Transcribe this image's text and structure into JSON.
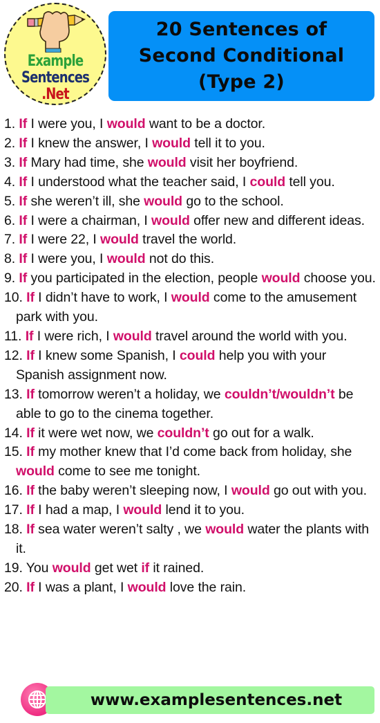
{
  "logo": {
    "line1": "Example",
    "line2": "Sentences",
    "line3": ".Net",
    "icon": "fist-holding-pencil-icon"
  },
  "title": {
    "line1": "20 Sentences of",
    "line2": "Second Conditional",
    "line3": "(Type 2)",
    "background": "#0590f7"
  },
  "highlight_color": "#d0106a",
  "sentences": [
    {
      "n": "1.",
      "parts": [
        {
          "t": "If",
          "h": true
        },
        {
          "t": " I were you, I "
        },
        {
          "t": "would",
          "h": true
        },
        {
          "t": " want to be a doctor."
        }
      ]
    },
    {
      "n": "2.",
      "parts": [
        {
          "t": "If",
          "h": true
        },
        {
          "t": " I knew the answer, I "
        },
        {
          "t": "would",
          "h": true
        },
        {
          "t": " tell it to you."
        }
      ]
    },
    {
      "n": "3.",
      "parts": [
        {
          "t": "If",
          "h": true
        },
        {
          "t": " Mary had time, she "
        },
        {
          "t": "would",
          "h": true
        },
        {
          "t": " visit her boyfriend."
        }
      ]
    },
    {
      "n": "4.",
      "parts": [
        {
          "t": "If",
          "h": true
        },
        {
          "t": " I understood what the teacher said, I "
        },
        {
          "t": "could",
          "h": true
        },
        {
          "t": " tell you."
        }
      ]
    },
    {
      "n": "5.",
      "parts": [
        {
          "t": "If",
          "h": true
        },
        {
          "t": " she weren’t ill, she "
        },
        {
          "t": "would",
          "h": true
        },
        {
          "t": " go to the school."
        }
      ]
    },
    {
      "n": "6.",
      "parts": [
        {
          "t": "If",
          "h": true
        },
        {
          "t": " I were a chairman, I "
        },
        {
          "t": "would",
          "h": true
        },
        {
          "t": " offer new and different ideas."
        }
      ]
    },
    {
      "n": "7.",
      "parts": [
        {
          "t": "If",
          "h": true
        },
        {
          "t": " I were 22, I "
        },
        {
          "t": "would",
          "h": true
        },
        {
          "t": " travel the world."
        }
      ]
    },
    {
      "n": "8.",
      "parts": [
        {
          "t": "If",
          "h": true
        },
        {
          "t": " I were you, I "
        },
        {
          "t": "would",
          "h": true
        },
        {
          "t": " not do this."
        }
      ]
    },
    {
      "n": "9.",
      "parts": [
        {
          "t": "If",
          "h": true
        },
        {
          "t": " you participated in the election, people "
        },
        {
          "t": "would",
          "h": true
        },
        {
          "t": " choose you."
        }
      ]
    },
    {
      "n": "10.",
      "parts": [
        {
          "t": "If",
          "h": true
        },
        {
          "t": " I didn’t have to work, I "
        },
        {
          "t": "would",
          "h": true
        },
        {
          "t": " come to the amusement park with you."
        }
      ]
    },
    {
      "n": "11.",
      "parts": [
        {
          "t": "If",
          "h": true
        },
        {
          "t": " I were rich, I "
        },
        {
          "t": "would",
          "h": true
        },
        {
          "t": " travel around the world with you."
        }
      ]
    },
    {
      "n": "12.",
      "parts": [
        {
          "t": "If",
          "h": true
        },
        {
          "t": " I knew some Spanish, I "
        },
        {
          "t": "could",
          "h": true
        },
        {
          "t": " help you with your Spanish assignment now."
        }
      ]
    },
    {
      "n": "13.",
      "parts": [
        {
          "t": "If",
          "h": true
        },
        {
          "t": " tomorrow weren’t a holiday, we "
        },
        {
          "t": "couldn’t/wouldn’t",
          "h": true
        },
        {
          "t": " be able to go to the cinema together."
        }
      ]
    },
    {
      "n": "14.",
      "parts": [
        {
          "t": "If",
          "h": true
        },
        {
          "t": " it were wet now, we "
        },
        {
          "t": "couldn’t",
          "h": true
        },
        {
          "t": " go out for a walk."
        }
      ]
    },
    {
      "n": "15.",
      "parts": [
        {
          "t": "If",
          "h": true
        },
        {
          "t": " my mother knew that I’d come back from holiday, she "
        },
        {
          "t": "would",
          "h": true
        },
        {
          "t": " come to see me tonight."
        }
      ]
    },
    {
      "n": "16.",
      "parts": [
        {
          "t": "If",
          "h": true
        },
        {
          "t": " the baby weren’t sleeping now, I "
        },
        {
          "t": "would",
          "h": true
        },
        {
          "t": " go out with you."
        }
      ]
    },
    {
      "n": "17.",
      "parts": [
        {
          "t": "If",
          "h": true
        },
        {
          "t": " I had a map, I "
        },
        {
          "t": "would",
          "h": true
        },
        {
          "t": " lend it to you."
        }
      ]
    },
    {
      "n": "18.",
      "parts": [
        {
          "t": "If",
          "h": true
        },
        {
          "t": " sea water weren’t salty , we "
        },
        {
          "t": "would",
          "h": true
        },
        {
          "t": " water the plants with it."
        }
      ]
    },
    {
      "n": "19.",
      "parts": [
        {
          "t": "You "
        },
        {
          "t": "would",
          "h": true
        },
        {
          "t": " get wet "
        },
        {
          "t": "if",
          "h": true
        },
        {
          "t": " it rained."
        }
      ]
    },
    {
      "n": "20.",
      "parts": [
        {
          "t": "If",
          "h": true
        },
        {
          "t": " I was a plant, I "
        },
        {
          "t": "would",
          "h": true
        },
        {
          "t": " love the rain."
        }
      ]
    }
  ],
  "footer": {
    "url": "www.examplesentences.net",
    "icon": "globe-icon",
    "background": "#a3f7a0"
  }
}
